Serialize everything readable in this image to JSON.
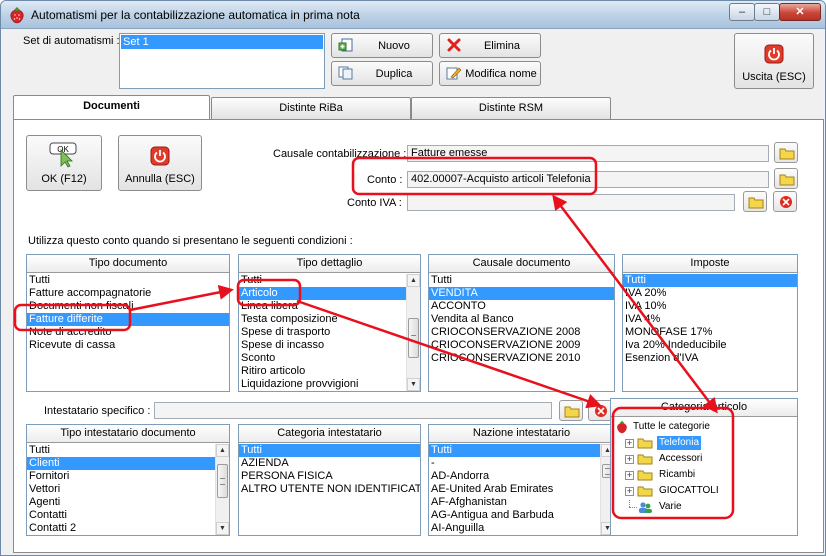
{
  "window": {
    "title": "Automatismi per la contabilizzazione automatica in prima nota",
    "minimize": "–",
    "maximize": "□",
    "close": "✕"
  },
  "top": {
    "set_label": "Set di automatismi :",
    "sets": [
      "Set 1"
    ],
    "nuovo": "Nuovo",
    "elimina": "Elimina",
    "duplica": "Duplica",
    "modifica_nome": "Modifica nome",
    "uscita": "Uscita (ESC)"
  },
  "tabs": [
    "Documenti",
    "Distinte RiBa",
    "Distinte RSM"
  ],
  "doc": {
    "ok_icon_text": "OK",
    "ok": "OK (F12)",
    "annulla": "Annulla (ESC)",
    "causale_label": "Causale contabilizzazione :",
    "causale_value": "Fatture emesse",
    "conto_label": "Conto :",
    "conto_value": "402.00007-Acquisto articoli Telefonia",
    "conto_iva_label": "Conto IVA :",
    "conto_iva_value": "",
    "conditions_text": "Utilizza questo conto quando si presentano le seguenti condizioni :"
  },
  "lists": {
    "tipo_documento": {
      "header": "Tipo documento",
      "items": [
        "Tutti",
        "Fatture accompagnatorie",
        "Documenti non fiscali",
        "Fatture differite",
        "Note di accredito",
        "Ricevute di cassa"
      ],
      "selected": 3
    },
    "tipo_dettaglio": {
      "header": "Tipo dettaglio",
      "items": [
        "Tutti",
        "Articolo",
        "Linea libera",
        "Testa composizione",
        "Spese di trasporto",
        "Spese di incasso",
        "Sconto",
        "Ritiro articolo",
        "Liquidazione provvigioni"
      ],
      "selected": 1
    },
    "causale_documento": {
      "header": "Causale documento",
      "items": [
        "Tutti",
        "VENDITA",
        "ACCONTO",
        "Vendita al Banco",
        "CRIOCONSERVAZIONE 2008",
        "CRIOCONSERVAZIONE 2009",
        "CRIOCONSERVAZIONE 2010"
      ],
      "selected": 1
    },
    "imposte": {
      "header": "Imposte",
      "items": [
        "Tutti",
        "IVA 20%",
        "IVA 10%",
        "IVA 4%",
        "MONOFASE 17%",
        "Iva 20% Indeducibile",
        "Esenzion d'IVA"
      ],
      "selected": 0
    },
    "tipo_intestatario": {
      "header": "Tipo intestatario documento",
      "items": [
        "Tutti",
        "Clienti",
        "Fornitori",
        "Vettori",
        "Agenti",
        "Contatti",
        "Contatti 2"
      ],
      "selected": 1
    },
    "categoria_intestatario": {
      "header": "Categoria intestatario",
      "items": [
        "Tutti",
        "AZIENDA",
        "PERSONA FISICA",
        "ALTRO UTENTE NON IDENTIFICAT"
      ],
      "selected": 0
    },
    "nazione_intestatario": {
      "header": "Nazione intestatario",
      "items": [
        "Tutti",
        "-",
        "AD-Andorra",
        "AE-United Arab Emirates",
        "AF-Afghanistan",
        "AG-Antigua and Barbuda",
        "AI-Anguilla"
      ],
      "selected": 0
    }
  },
  "intestatario": {
    "label": "Intestatario specifico :",
    "value": ""
  },
  "categoria_articolo": {
    "header": "Categoria articolo",
    "root": "Tutte le categorie",
    "nodes": [
      "Telefonia",
      "Accessori",
      "Ricambi",
      "GIOCATTOLI",
      "Varie"
    ],
    "selected": 0
  },
  "colors": {
    "selection": "#3399ff",
    "annotation": "#e8101c"
  }
}
